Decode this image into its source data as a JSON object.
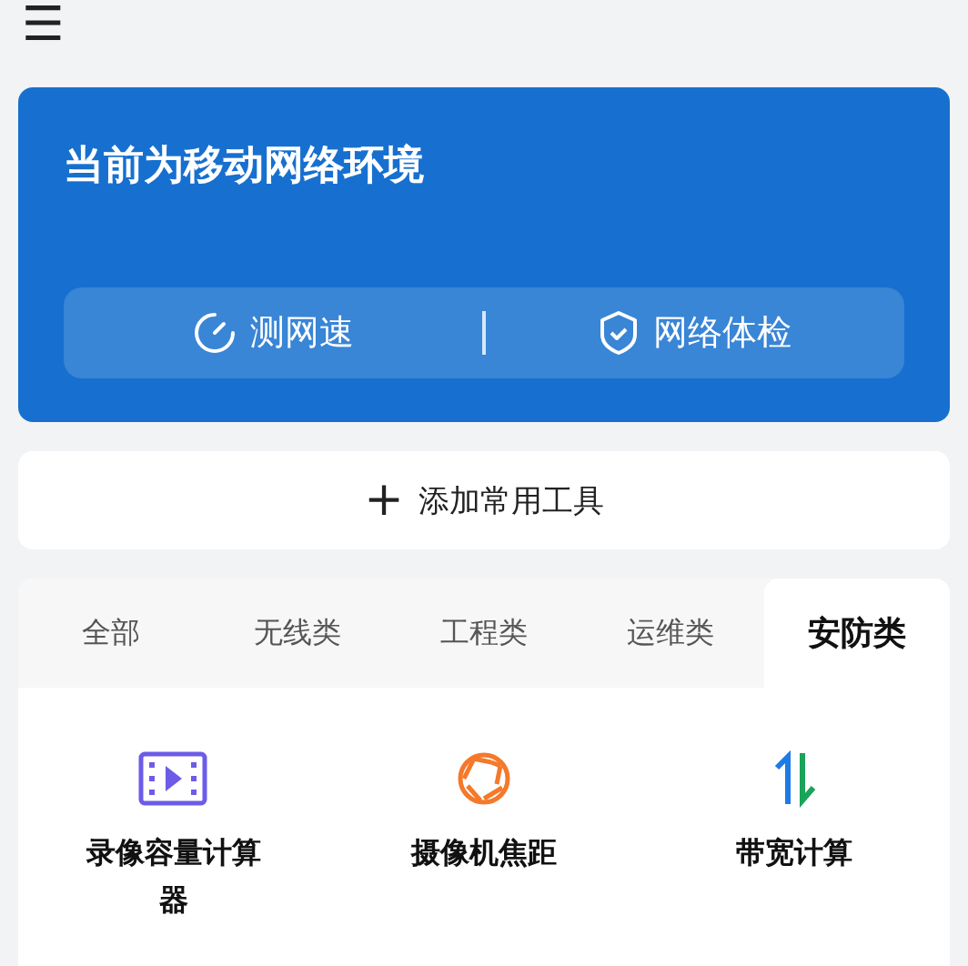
{
  "header": {
    "menu_icon": "☰"
  },
  "network_card": {
    "title": "当前为移动网络环境",
    "actions": [
      {
        "kind": "speed",
        "label": "测网速"
      },
      {
        "kind": "shield",
        "label": "网络体检"
      }
    ]
  },
  "add_button": {
    "icon": "+",
    "label": "添加常用工具"
  },
  "tabs": [
    {
      "label": "全部",
      "selected": false
    },
    {
      "label": "无线类",
      "selected": false
    },
    {
      "label": "工程类",
      "selected": false
    },
    {
      "label": "运维类",
      "selected": false
    },
    {
      "label": "安防类",
      "selected": true
    }
  ],
  "tools": [
    {
      "kind": "film",
      "label": "录像容量计算器"
    },
    {
      "kind": "aperture",
      "label": "摄像机焦距"
    },
    {
      "kind": "arrows",
      "label": "带宽计算"
    }
  ]
}
